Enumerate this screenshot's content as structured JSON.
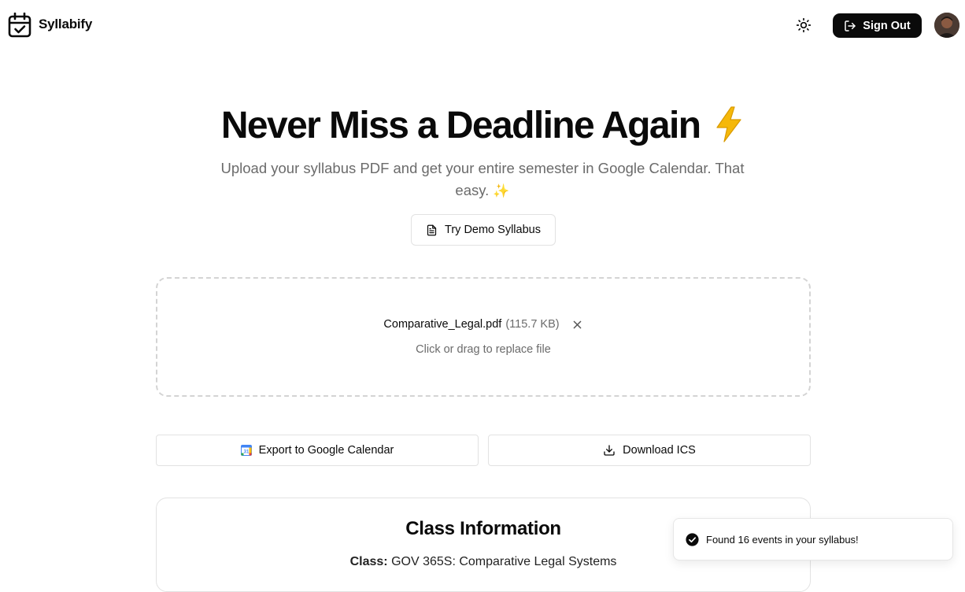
{
  "header": {
    "brand": "Syllabify",
    "logo_icon": "calendar-check-icon",
    "theme_icon": "sun-icon",
    "signout_label": "Sign Out",
    "signout_icon": "log-out-icon",
    "avatar_icon": "user-avatar"
  },
  "hero": {
    "title": "Never Miss a Deadline Again",
    "title_emoji_icon": "lightning-bolt-icon",
    "subtitle": "Upload your syllabus PDF and get your entire semester in Google Calendar. That easy.",
    "subtitle_emoji": "✨",
    "demo_button_label": "Try Demo Syllabus",
    "demo_button_icon": "file-text-icon"
  },
  "upload": {
    "file_name": "Comparative_Legal.pdf",
    "file_size": "(115.7 KB)",
    "remove_icon": "close-icon",
    "hint": "Click or drag to replace file"
  },
  "actions": {
    "export_label": "Export to Google Calendar",
    "export_icon": "google-calendar-icon",
    "ics_label": "Download ICS",
    "ics_icon": "download-icon"
  },
  "class_info": {
    "title": "Class Information",
    "class_label": "Class:",
    "class_value": "GOV 365S: Comparative Legal Systems"
  },
  "toast": {
    "icon": "check-circle-icon",
    "message": "Found 16 events in your syllabus!"
  },
  "colors": {
    "primary": "#0a0a0a",
    "muted_text": "#6b6b6b",
    "border": "#e2e2e2",
    "bolt": "#f5b80a"
  }
}
